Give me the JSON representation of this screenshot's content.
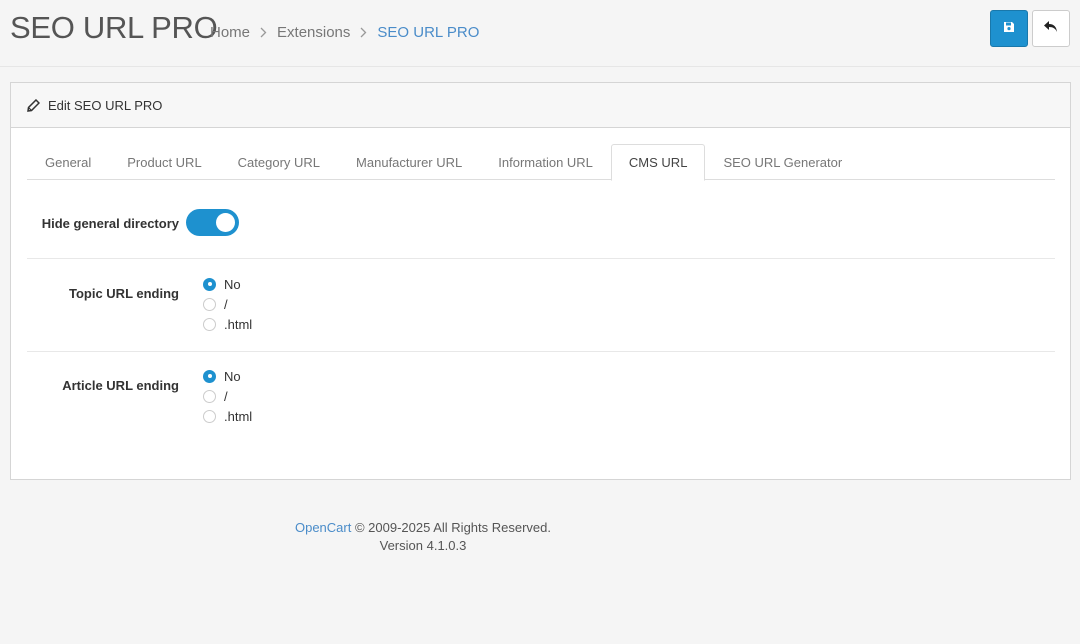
{
  "header": {
    "title": "SEO URL PRO",
    "breadcrumbs": [
      "Home",
      "Extensions",
      "SEO URL PRO"
    ]
  },
  "card": {
    "title": "Edit SEO URL PRO"
  },
  "tabs": [
    {
      "label": "General",
      "active": false
    },
    {
      "label": "Product URL",
      "active": false
    },
    {
      "label": "Category URL",
      "active": false
    },
    {
      "label": "Manufacturer URL",
      "active": false
    },
    {
      "label": "Information URL",
      "active": false
    },
    {
      "label": "CMS URL",
      "active": true
    },
    {
      "label": "SEO URL Generator",
      "active": false
    }
  ],
  "fields": {
    "hide_general_directory": {
      "label": "Hide general directory",
      "enabled": true
    },
    "topic_url_ending": {
      "label": "Topic URL ending",
      "options": [
        "No",
        "/",
        ".html"
      ],
      "selected": "No"
    },
    "article_url_ending": {
      "label": "Article URL ending",
      "options": [
        "No",
        "/",
        ".html"
      ],
      "selected": "No"
    }
  },
  "footer": {
    "brand": "OpenCart",
    "copyright": "© 2009-2025 All Rights Reserved.",
    "version": "Version 4.1.0.3"
  },
  "colors": {
    "accent": "#1e91cf",
    "link": "#4a8cc9"
  }
}
